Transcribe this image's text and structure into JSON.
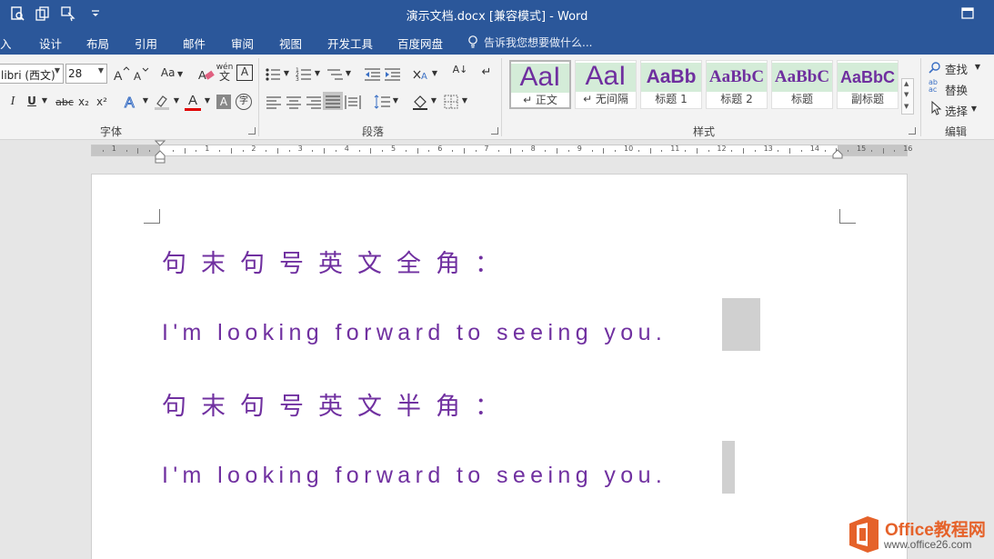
{
  "app": {
    "title": "演示文档.docx [兼容模式] - Word"
  },
  "tabs": [
    "入",
    "设计",
    "布局",
    "引用",
    "邮件",
    "审阅",
    "视图",
    "开发工具",
    "百度网盘"
  ],
  "tell_me": "告诉我您想要做什么...",
  "ribbon": {
    "font_name": "libri (西文)",
    "font_size": "28",
    "groups": {
      "font": "字体",
      "paragraph": "段落",
      "styles": "样式",
      "editing": "编辑"
    },
    "styles": [
      {
        "sample": "AaI",
        "name": "↵ 正文"
      },
      {
        "sample": "AaI",
        "name": "↵ 无间隔"
      },
      {
        "sample": "AaBb",
        "name": "标题 1"
      },
      {
        "sample": "AaBbC",
        "name": "标题 2"
      },
      {
        "sample": "AaBbC",
        "name": "标题"
      },
      {
        "sample": "AaBbC",
        "name": "副标题"
      }
    ],
    "editing": {
      "find": "查找",
      "replace": "替换",
      "select": "选择"
    },
    "labels": {
      "aa": "Aa",
      "wen": "wén",
      "wen_char": "文",
      "boxed_a": "A",
      "italic": "I",
      "underline": "U",
      "strike": "abc",
      "subscript": "x₂",
      "superscript": "x²",
      "font_color": "A",
      "char_shade": "A",
      "enclose": "字",
      "sort": "A↓",
      "pilcrow": "↵"
    }
  },
  "ruler": {
    "numbers": [
      "1",
      "1",
      "2",
      "3",
      "4",
      "5",
      "6",
      "7",
      "8",
      "9",
      "10",
      "11",
      "12",
      "13",
      "14",
      "15",
      "16"
    ]
  },
  "document": {
    "lines": [
      "句末句号英文全角：",
      "I'm looking forward to seeing you.",
      "句末句号英文半角：",
      "I'm looking forward to seeing you."
    ],
    "text_color": "#7030a0"
  },
  "watermark": {
    "line1": "Office教程网",
    "line2": "www.office26.com"
  },
  "colors": {
    "brand": "#2b579a",
    "accent": "#e5622a"
  }
}
